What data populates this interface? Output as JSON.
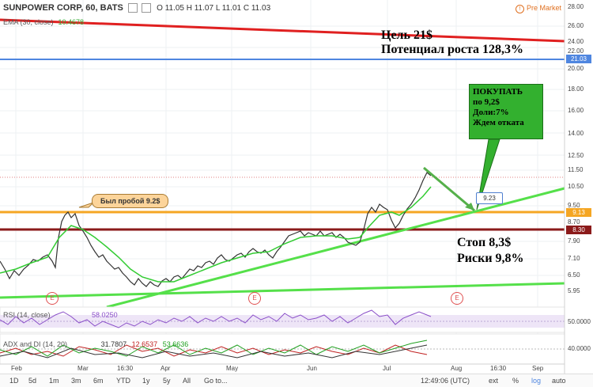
{
  "header": {
    "symbol": "SUNPOWER CORP, 60, BATS",
    "ohlc": "O 11.05  H 11.07  L 11.01  C 11.03",
    "ema_label": "EMA (30, close)",
    "ema_value": "10.4678",
    "premarket": "Pre Market"
  },
  "annotations": {
    "target_line1": "Цель 21$",
    "target_line2": "Потенциал роста 128,3%",
    "buy_box": [
      "ПОКУПАТЬ",
      "по 9,2$",
      "Доли:7%",
      "Ждем отката"
    ],
    "breakout": "Был пробой 9.2$",
    "stop_line1": "Стоп 8,3$",
    "stop_line2": "Риски 9,8%",
    "tag_923": "9.23",
    "earnings_marker": "E"
  },
  "price_axis": {
    "labels": [
      "28.00",
      "26.00",
      "24.00",
      "22.00",
      "20.00",
      "18.00",
      "16.00",
      "14.00",
      "12.50",
      "11.50",
      "10.50",
      "9.50",
      "8.70",
      "7.90",
      "7.10",
      "6.50",
      "5.95"
    ],
    "tags": [
      {
        "value": "21.03",
        "color": "#4f86e0"
      },
      {
        "value": "9.13",
        "color": "#f5a623"
      },
      {
        "value": "8.30",
        "color": "#8b1a1a"
      }
    ]
  },
  "x_axis": {
    "labels": [
      "Feb",
      "Mar",
      "16:30",
      "Apr",
      "May",
      "Jun",
      "Jul",
      "Aug",
      "16:30",
      "Sep"
    ]
  },
  "rsi": {
    "label": "RSI (14, close)",
    "value": "58.0250",
    "axis": "50.0000"
  },
  "adx": {
    "label": "ADX and DI (14, 20)",
    "values": [
      "31.7807",
      "12.6537",
      "53.6636"
    ],
    "axis": "40.0000"
  },
  "timeframe_bar": {
    "ranges": [
      "1D",
      "5d",
      "1m",
      "3m",
      "6m",
      "YTD",
      "1y",
      "5y",
      "All",
      "Go to..."
    ],
    "clock": "12:49:06 (UTC)",
    "toggles": [
      "ext",
      "%",
      "log",
      "auto"
    ]
  },
  "colors": {
    "target_line": "#e02020",
    "blue_line": "#4f86e0",
    "orange_line": "#f5a623",
    "stop_line": "#8b1a1a",
    "trend_green": "#55e04a",
    "ema_green": "#33cc33",
    "buy_box": "#33b02f"
  }
}
